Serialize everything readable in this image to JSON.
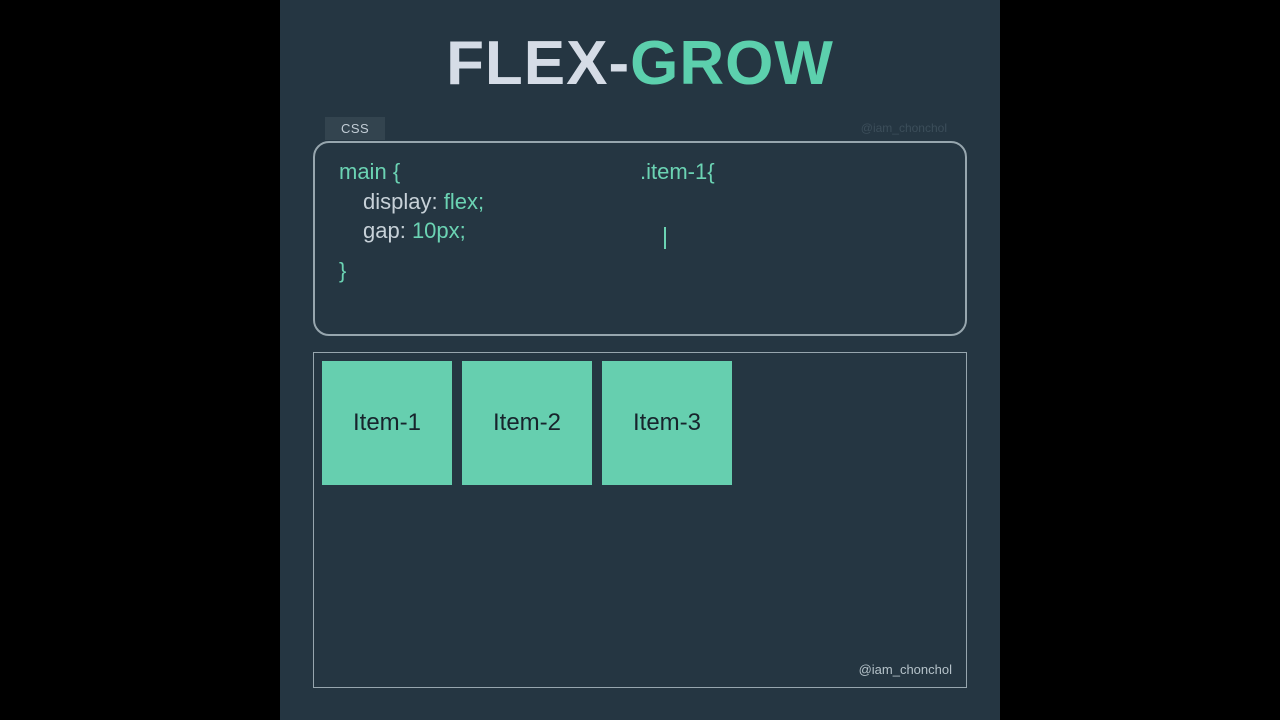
{
  "title": {
    "word1": "FLEX-",
    "word2": "GROW"
  },
  "tab": {
    "label": "CSS"
  },
  "watermark": "@iam_chonchol",
  "code": {
    "left": {
      "selector": "main",
      "open": "{",
      "line1_prop": "display:",
      "line1_val": " flex;",
      "line2_prop": "gap:",
      "line2_val": " 10px;",
      "close": "}"
    },
    "right": {
      "selector": ".item-1",
      "open": "{"
    }
  },
  "demo": {
    "items": {
      "0": "Item-1",
      "1": "Item-2",
      "2": "Item-3"
    }
  }
}
